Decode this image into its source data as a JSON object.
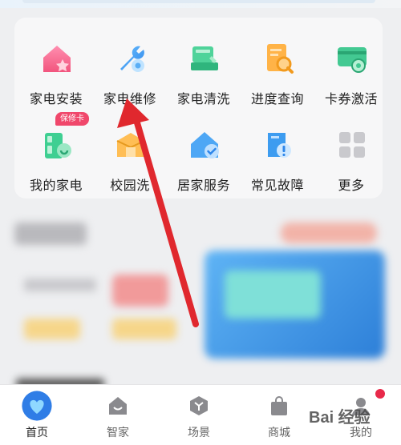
{
  "services": {
    "items": [
      {
        "label": "家电安装",
        "icon": "house-star-icon"
      },
      {
        "label": "家电维修",
        "icon": "wrench-icon"
      },
      {
        "label": "家电清洗",
        "icon": "cleaning-appliance-icon"
      },
      {
        "label": "进度查询",
        "icon": "progress-search-icon"
      },
      {
        "label": "卡券激活",
        "icon": "coupon-activate-icon"
      },
      {
        "label": "我的家电",
        "icon": "my-appliance-icon"
      },
      {
        "label": "校园洗",
        "icon": "campus-wash-icon"
      },
      {
        "label": "居家服务",
        "icon": "home-service-icon"
      },
      {
        "label": "常见故障",
        "icon": "fault-icon"
      },
      {
        "label": "更多",
        "icon": "more-grid-icon"
      }
    ],
    "warranty_badge": "保修卡"
  },
  "bottom_nav": {
    "items": [
      {
        "label": "首页",
        "icon": "home-heart-icon",
        "active": true
      },
      {
        "label": "智家",
        "icon": "smart-home-icon",
        "active": false
      },
      {
        "label": "场景",
        "icon": "scene-icon",
        "active": false
      },
      {
        "label": "商城",
        "icon": "shopping-bag-icon",
        "active": false
      },
      {
        "label": "我的",
        "icon": "profile-icon",
        "active": false
      }
    ]
  },
  "watermark": "Bai 经验",
  "colors": {
    "accent_blue": "#3d9cf0",
    "badge_red": "#f0476b",
    "arrow_red": "#e0282e"
  }
}
